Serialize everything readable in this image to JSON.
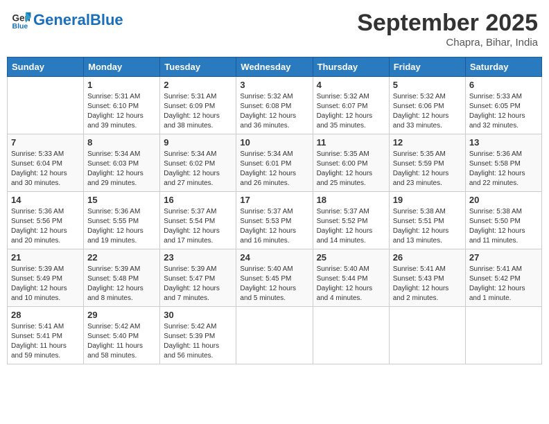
{
  "header": {
    "logo_line1": "General",
    "logo_line2": "Blue",
    "month": "September 2025",
    "location": "Chapra, Bihar, India"
  },
  "weekdays": [
    "Sunday",
    "Monday",
    "Tuesday",
    "Wednesday",
    "Thursday",
    "Friday",
    "Saturday"
  ],
  "weeks": [
    [
      {
        "day": "",
        "text": ""
      },
      {
        "day": "1",
        "text": "Sunrise: 5:31 AM\nSunset: 6:10 PM\nDaylight: 12 hours\nand 39 minutes."
      },
      {
        "day": "2",
        "text": "Sunrise: 5:31 AM\nSunset: 6:09 PM\nDaylight: 12 hours\nand 38 minutes."
      },
      {
        "day": "3",
        "text": "Sunrise: 5:32 AM\nSunset: 6:08 PM\nDaylight: 12 hours\nand 36 minutes."
      },
      {
        "day": "4",
        "text": "Sunrise: 5:32 AM\nSunset: 6:07 PM\nDaylight: 12 hours\nand 35 minutes."
      },
      {
        "day": "5",
        "text": "Sunrise: 5:32 AM\nSunset: 6:06 PM\nDaylight: 12 hours\nand 33 minutes."
      },
      {
        "day": "6",
        "text": "Sunrise: 5:33 AM\nSunset: 6:05 PM\nDaylight: 12 hours\nand 32 minutes."
      }
    ],
    [
      {
        "day": "7",
        "text": "Sunrise: 5:33 AM\nSunset: 6:04 PM\nDaylight: 12 hours\nand 30 minutes."
      },
      {
        "day": "8",
        "text": "Sunrise: 5:34 AM\nSunset: 6:03 PM\nDaylight: 12 hours\nand 29 minutes."
      },
      {
        "day": "9",
        "text": "Sunrise: 5:34 AM\nSunset: 6:02 PM\nDaylight: 12 hours\nand 27 minutes."
      },
      {
        "day": "10",
        "text": "Sunrise: 5:34 AM\nSunset: 6:01 PM\nDaylight: 12 hours\nand 26 minutes."
      },
      {
        "day": "11",
        "text": "Sunrise: 5:35 AM\nSunset: 6:00 PM\nDaylight: 12 hours\nand 25 minutes."
      },
      {
        "day": "12",
        "text": "Sunrise: 5:35 AM\nSunset: 5:59 PM\nDaylight: 12 hours\nand 23 minutes."
      },
      {
        "day": "13",
        "text": "Sunrise: 5:36 AM\nSunset: 5:58 PM\nDaylight: 12 hours\nand 22 minutes."
      }
    ],
    [
      {
        "day": "14",
        "text": "Sunrise: 5:36 AM\nSunset: 5:56 PM\nDaylight: 12 hours\nand 20 minutes."
      },
      {
        "day": "15",
        "text": "Sunrise: 5:36 AM\nSunset: 5:55 PM\nDaylight: 12 hours\nand 19 minutes."
      },
      {
        "day": "16",
        "text": "Sunrise: 5:37 AM\nSunset: 5:54 PM\nDaylight: 12 hours\nand 17 minutes."
      },
      {
        "day": "17",
        "text": "Sunrise: 5:37 AM\nSunset: 5:53 PM\nDaylight: 12 hours\nand 16 minutes."
      },
      {
        "day": "18",
        "text": "Sunrise: 5:37 AM\nSunset: 5:52 PM\nDaylight: 12 hours\nand 14 minutes."
      },
      {
        "day": "19",
        "text": "Sunrise: 5:38 AM\nSunset: 5:51 PM\nDaylight: 12 hours\nand 13 minutes."
      },
      {
        "day": "20",
        "text": "Sunrise: 5:38 AM\nSunset: 5:50 PM\nDaylight: 12 hours\nand 11 minutes."
      }
    ],
    [
      {
        "day": "21",
        "text": "Sunrise: 5:39 AM\nSunset: 5:49 PM\nDaylight: 12 hours\nand 10 minutes."
      },
      {
        "day": "22",
        "text": "Sunrise: 5:39 AM\nSunset: 5:48 PM\nDaylight: 12 hours\nand 8 minutes."
      },
      {
        "day": "23",
        "text": "Sunrise: 5:39 AM\nSunset: 5:47 PM\nDaylight: 12 hours\nand 7 minutes."
      },
      {
        "day": "24",
        "text": "Sunrise: 5:40 AM\nSunset: 5:45 PM\nDaylight: 12 hours\nand 5 minutes."
      },
      {
        "day": "25",
        "text": "Sunrise: 5:40 AM\nSunset: 5:44 PM\nDaylight: 12 hours\nand 4 minutes."
      },
      {
        "day": "26",
        "text": "Sunrise: 5:41 AM\nSunset: 5:43 PM\nDaylight: 12 hours\nand 2 minutes."
      },
      {
        "day": "27",
        "text": "Sunrise: 5:41 AM\nSunset: 5:42 PM\nDaylight: 12 hours\nand 1 minute."
      }
    ],
    [
      {
        "day": "28",
        "text": "Sunrise: 5:41 AM\nSunset: 5:41 PM\nDaylight: 11 hours\nand 59 minutes."
      },
      {
        "day": "29",
        "text": "Sunrise: 5:42 AM\nSunset: 5:40 PM\nDaylight: 11 hours\nand 58 minutes."
      },
      {
        "day": "30",
        "text": "Sunrise: 5:42 AM\nSunset: 5:39 PM\nDaylight: 11 hours\nand 56 minutes."
      },
      {
        "day": "",
        "text": ""
      },
      {
        "day": "",
        "text": ""
      },
      {
        "day": "",
        "text": ""
      },
      {
        "day": "",
        "text": ""
      }
    ]
  ]
}
